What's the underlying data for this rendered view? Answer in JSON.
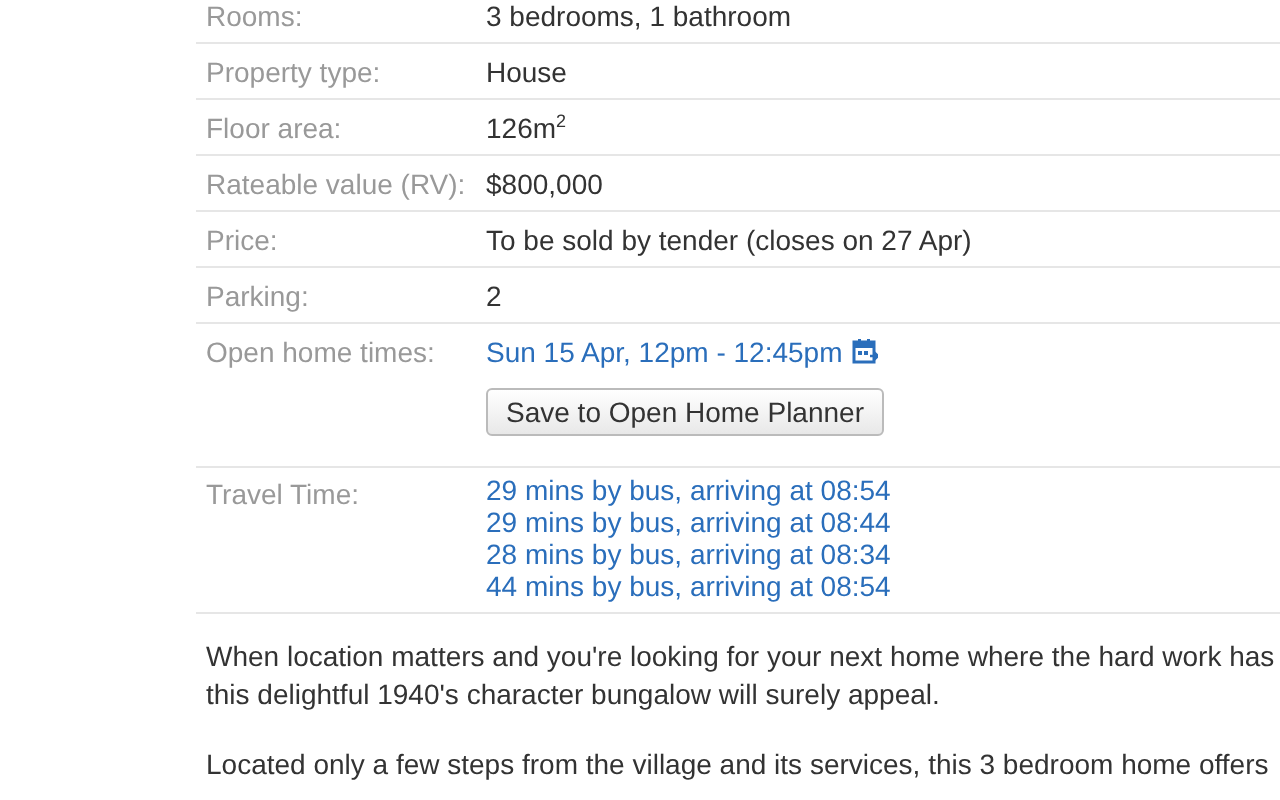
{
  "details": [
    {
      "kind": "text",
      "label": "Rooms:",
      "value": "3 bedrooms, 1 bathroom"
    },
    {
      "kind": "text",
      "label": "Property type:",
      "value": "House"
    },
    {
      "kind": "text",
      "label": "Floor area:",
      "value": "126m$^{2}$"
    },
    {
      "kind": "text",
      "label": "Rateable value (RV):",
      "value": "$800,000"
    },
    {
      "kind": "text",
      "label": "Price:",
      "value": "To be sold by tender (closes on 27 Apr)"
    },
    {
      "kind": "text",
      "label": "Parking:",
      "value": "2"
    },
    {
      "kind": "open_home",
      "label": "Open home times:",
      "value": "Sun 15 Apr, 12pm - 12:45pm",
      "button": "Save to Open Home Planner"
    },
    {
      "kind": "links",
      "label": "Travel Time:",
      "links": [
        "29 mins by bus, arriving at 08:54",
        "29 mins by bus, arriving at 08:44",
        "28 mins by bus, arriving at 08:34",
        "44 mins by bus, arriving at 08:54"
      ]
    }
  ],
  "description": [
    [
      "When location matters and you're looking for your next home where the hard work has",
      "this delightful 1940's character bungalow will surely appeal."
    ],
    [
      "Located only a few steps from the village and its services, this 3 bedroom home offers"
    ]
  ]
}
